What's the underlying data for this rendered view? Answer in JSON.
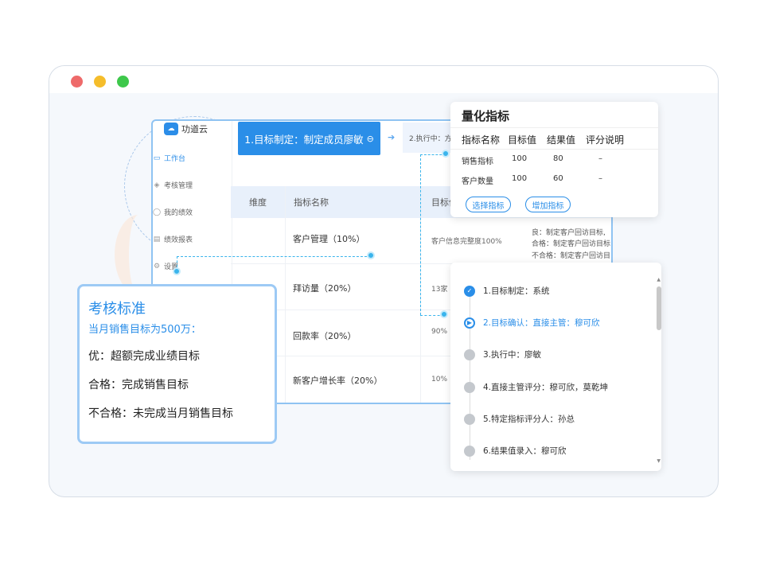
{
  "app": {
    "logo_text": "功道云",
    "logo_glyph": "☁",
    "nav": [
      {
        "label": "工作台",
        "icon": "monitor-icon",
        "active": true
      },
      {
        "label": "考核管理",
        "icon": "stack-icon",
        "active": false
      },
      {
        "label": "我的绩效",
        "icon": "user-icon",
        "active": false
      },
      {
        "label": "绩效报表",
        "icon": "report-icon",
        "active": false
      },
      {
        "label": "设置",
        "icon": "gear-icon",
        "active": false
      }
    ],
    "steps": {
      "active_label": "1.目标制定：制定成员廖敏",
      "next_label": "2.执行中：方"
    },
    "table": {
      "headers": {
        "dimension": "维度",
        "name": "指标名称",
        "target": "目标值"
      },
      "rows": [
        {
          "name": "客户管理（10%）",
          "target": "客户信息完整度100%"
        },
        {
          "name": "拜访量（20%）",
          "target": "13家"
        },
        {
          "name": "回款率（20%）",
          "target": "90%"
        },
        {
          "name": "新客户增长率（20%）",
          "target": "10%"
        }
      ],
      "evaluation": [
        "良：制定客户回访目标,",
        "合格：制定客户回访目标",
        "不合格：制定客户回访目"
      ]
    }
  },
  "quant": {
    "title": "量化指标",
    "headers": [
      "指标名称",
      "目标值",
      "结果值",
      "评分说明"
    ],
    "rows": [
      {
        "name": "销售指标",
        "target": "100",
        "result": "80",
        "note": "–"
      },
      {
        "name": "客户数量",
        "target": "100",
        "result": "60",
        "note": "–"
      }
    ],
    "select_button": "选择指标",
    "add_button": "增加指标"
  },
  "flow": {
    "steps": [
      {
        "label": "1.目标制定：系统",
        "state": "done"
      },
      {
        "label": "2.目标确认：直接主管：穆可欣",
        "state": "current"
      },
      {
        "label": "3.执行中：廖敏",
        "state": "pending"
      },
      {
        "label": "4.直接主管评分：穆可欣，莫乾坤",
        "state": "pending"
      },
      {
        "label": "5.特定指标评分人：孙总",
        "state": "pending"
      },
      {
        "label": "6.结果值录入：穆可欣",
        "state": "pending"
      }
    ]
  },
  "assess": {
    "title": "考核标准",
    "subtitle": "当月销售目标为500万：",
    "lines": [
      "优：超额完成业绩目标",
      "合格：完成销售目标",
      "不合格：未完成当月销售目标"
    ]
  },
  "colors": {
    "accent": "#2a8ee8",
    "connector": "#3ab4ec",
    "dot_red": "#ee6a6a",
    "dot_yellow": "#f5bd2b",
    "dot_green": "#3ec84b"
  }
}
